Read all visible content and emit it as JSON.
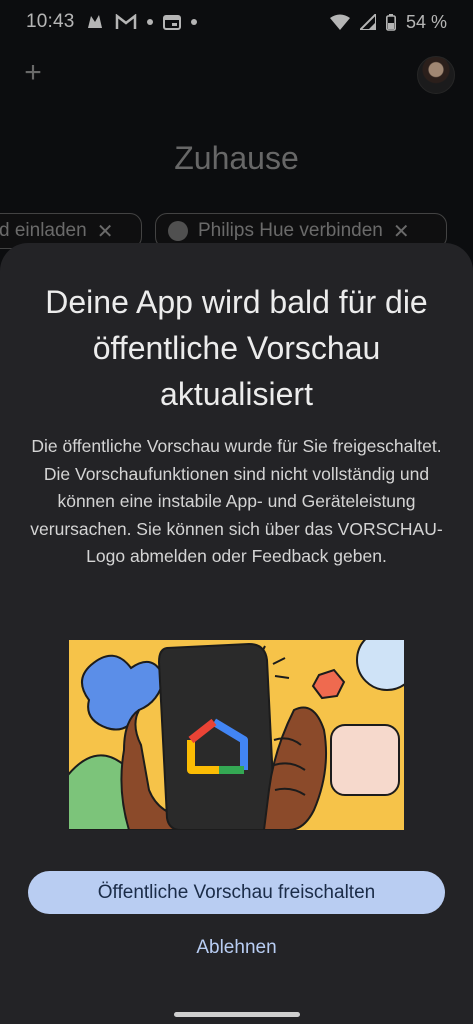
{
  "status_bar": {
    "time": "10:43",
    "battery": "54 %"
  },
  "app": {
    "page_title": "Zuhause",
    "chips": [
      {
        "label": "d einladen"
      },
      {
        "label": "Philips Hue verbinden"
      }
    ]
  },
  "dialog": {
    "title": "Deine App wird bald für die öffentliche Vorschau aktualisiert",
    "body": "Die öffentliche Vorschau wurde für Sie freigeschaltet. Die Vorschaufunktionen sind nicht vollständig und können eine instabile App- und Geräteleistung verursachen. Sie können sich über das VORSCHAU-Logo abmelden oder Feedback geben.",
    "primary_button": "Öffentliche Vorschau freischalten",
    "secondary_button": "Ablehnen"
  },
  "colors": {
    "sheet_bg": "#232326",
    "primary_button_bg": "#b9cdf2",
    "link_text": "#b8cdf3",
    "illustration_bg": "#f6c349"
  }
}
